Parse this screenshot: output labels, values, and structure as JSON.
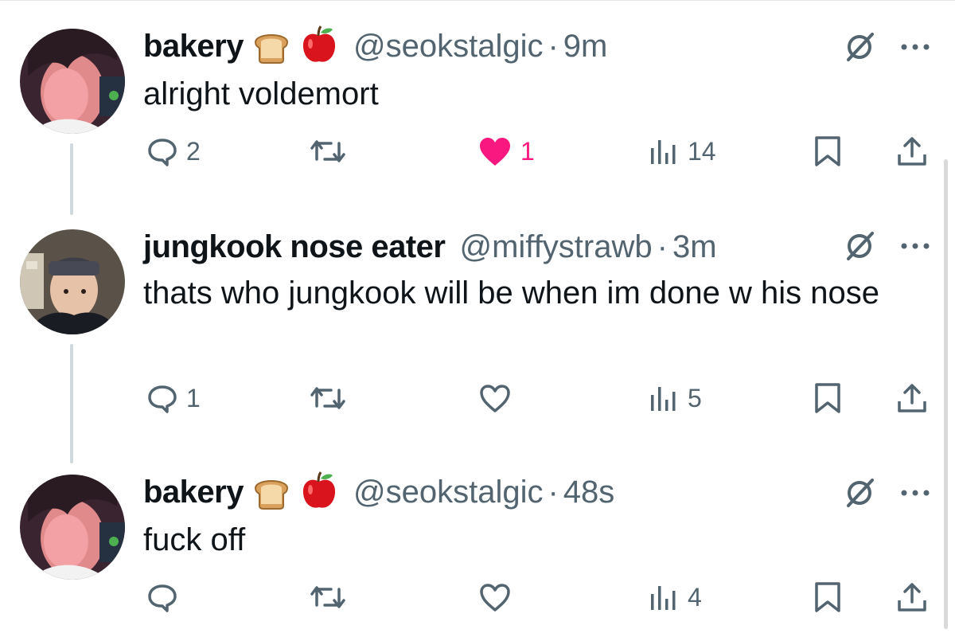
{
  "tweets": [
    {
      "name": "bakery",
      "handle": "@seokstalgic",
      "separator": "·",
      "time": "9m",
      "text": "alright voldemort",
      "reply_count": "2",
      "retweet_count": "",
      "like_count": "1",
      "liked": true,
      "views": "14",
      "avatar": "avatar-bakery",
      "emojis": [
        "bread-emoji",
        "apple-emoji"
      ]
    },
    {
      "name": "jungkook nose eater",
      "handle": "@miffystrawb",
      "separator": "·",
      "time": "3m",
      "text": "thats who jungkook will be when im done w his nose",
      "reply_count": "1",
      "retweet_count": "",
      "like_count": "",
      "liked": false,
      "views": "5",
      "avatar": "avatar-miffystrawb",
      "emojis": []
    },
    {
      "name": "bakery",
      "handle": "@seokstalgic",
      "separator": "·",
      "time": "48s",
      "text": "fuck off",
      "reply_count": "",
      "retweet_count": "",
      "like_count": "",
      "liked": false,
      "views": "4",
      "avatar": "avatar-bakery",
      "emojis": [
        "bread-emoji",
        "apple-emoji"
      ]
    }
  ],
  "colors": {
    "text_primary": "#0f1419",
    "text_secondary": "#536471",
    "like_active": "#f91880",
    "thread_line": "#cfd9de"
  }
}
